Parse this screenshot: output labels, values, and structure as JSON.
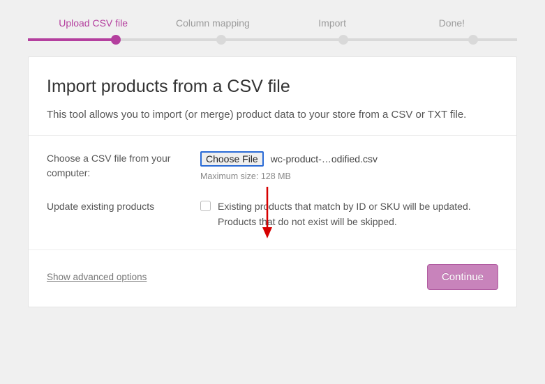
{
  "stepper": {
    "steps": [
      "Upload CSV file",
      "Column mapping",
      "Import",
      "Done!"
    ],
    "active_index": 0
  },
  "header": {
    "title": "Import products from a CSV file",
    "description": "This tool allows you to import (or merge) product data to your store from a CSV or TXT file."
  },
  "form": {
    "file_row": {
      "label": "Choose a CSV file from your computer:",
      "button_label": "Choose File",
      "file_name": "wc-product-…odified.csv",
      "hint": "Maximum size: 128 MB"
    },
    "update_row": {
      "label": "Update existing products",
      "checked": false,
      "description": "Existing products that match by ID or SKU will be updated. Products that do not exist will be skipped."
    }
  },
  "footer": {
    "advanced_link": "Show advanced options",
    "continue_label": "Continue"
  },
  "colors": {
    "accent": "#b43f9e",
    "button": "#c883bb"
  }
}
